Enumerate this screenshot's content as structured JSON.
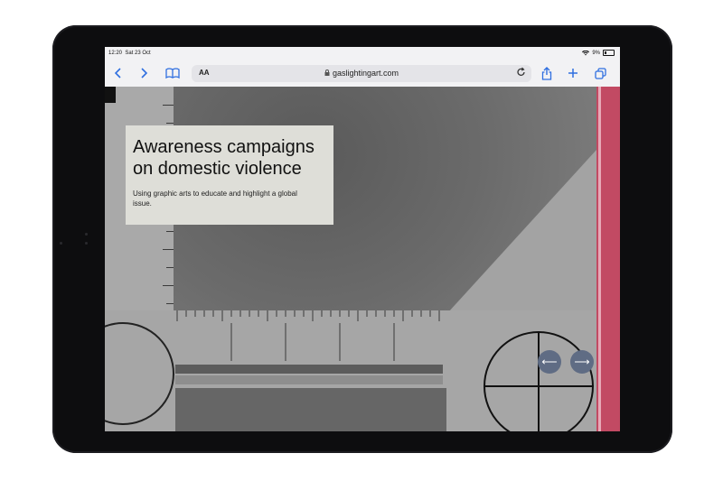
{
  "status_bar": {
    "time": "12:20",
    "date": "Sat 23 Oct",
    "battery": "9%"
  },
  "browser": {
    "text_size_label": "AA",
    "url": "gaslightingart.com",
    "icons": [
      "back-icon",
      "forward-icon",
      "bookmarks-icon",
      "lock-icon",
      "reload-icon",
      "share-icon",
      "new-tab-icon",
      "tabs-icon"
    ]
  },
  "hero": {
    "title": "Awareness campaigns on domestic violence",
    "subtitle": "Using graphic arts to educate and highlight a global issue."
  },
  "carousel": {
    "prev_label": "⟵",
    "next_label": "⟶"
  },
  "colors": {
    "accent_pink": "#c24a63",
    "nav_button": "#5f6c84",
    "card_bg": "#deded8",
    "safari_blue": "#2f6fe0"
  }
}
